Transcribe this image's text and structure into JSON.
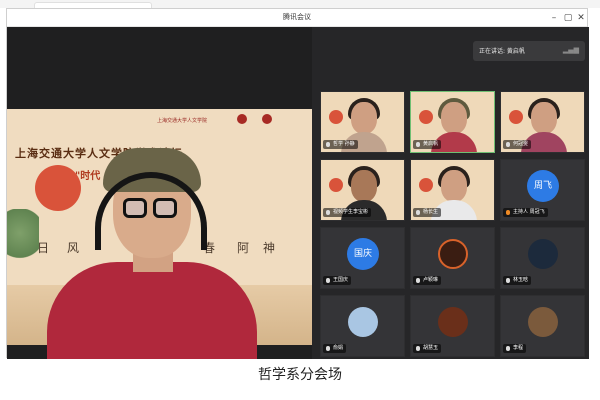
{
  "window": {
    "title": "腾讯会议",
    "minimize_icon": "minimize-icon",
    "maximize_icon": "maximize-icon",
    "close_icon": "close-icon"
  },
  "speaking_indicator": {
    "label": "正在讲话: 黄启帆",
    "icon": "signal-bars-icon"
  },
  "slide": {
    "university": "上海交通大学人文学院",
    "line1": "上海交通大学人文学院学术论坛",
    "line2": "\"时代 ... 青年担当\"",
    "vertical": [
      "阿",
      "神",
      "春",
      "风",
      "日"
    ]
  },
  "participants": [
    {
      "name": "哲学 孙静",
      "type": "video",
      "shirt": "#c0a38e",
      "active": false
    },
    {
      "name": "黄启帆",
      "type": "video",
      "shirt": "#b23a4a",
      "active": true
    },
    {
      "name": "何冠雯",
      "type": "video",
      "shirt": "#a04460",
      "active": false
    },
    {
      "name": "视频学生李宝彬",
      "type": "video",
      "shirt": "#2a2a2a",
      "active": false
    },
    {
      "name": "杨长生",
      "type": "video",
      "shirt": "#e9e9ea",
      "active": false
    },
    {
      "name": "主持人 周冠飞",
      "type": "avatar",
      "avatar_text": "周飞",
      "avatar_color": "#2d7be5"
    },
    {
      "name": "王国庆",
      "type": "avatar",
      "avatar_text": "国庆",
      "avatar_color": "#2d7be5"
    },
    {
      "name": "卢颖琳",
      "type": "image",
      "image_color": "#3a1d12"
    },
    {
      "name": "林玉晗",
      "type": "image",
      "image_color": "#1c2a3c"
    },
    {
      "name": "俞娟",
      "type": "image",
      "image_color": "#a9c6e3"
    },
    {
      "name": "胡慧玉",
      "type": "image",
      "image_color": "#6a2f1a"
    },
    {
      "name": "李程",
      "type": "image",
      "image_color": "#7b5a3c"
    }
  ],
  "caption": "哲学系分会场"
}
